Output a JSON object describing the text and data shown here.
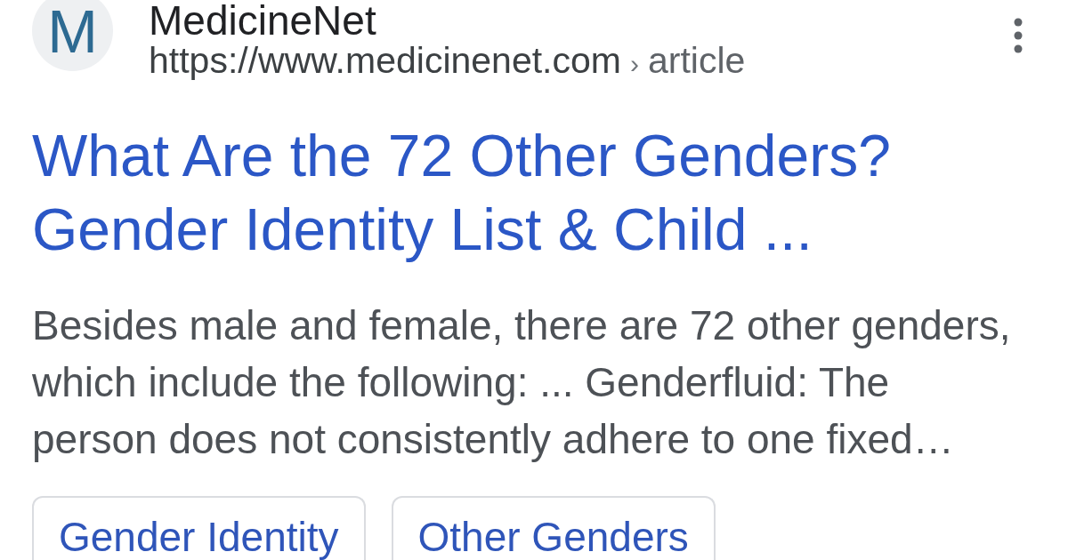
{
  "result": {
    "site_name": "MedicineNet",
    "favicon_letter": "M",
    "url": "https://www.medicinenet.com",
    "breadcrumb_separator": "›",
    "breadcrumb": "article",
    "title": "What Are the 72 Other Genders? Gender Identity List & Child ...",
    "snippet": "Besides male and female, there are 72 other genders, which include the following: ... Genderfluid: The person does not consistently adhere to one fixed…",
    "chips": [
      "Gender Identity",
      "Other Genders"
    ]
  }
}
